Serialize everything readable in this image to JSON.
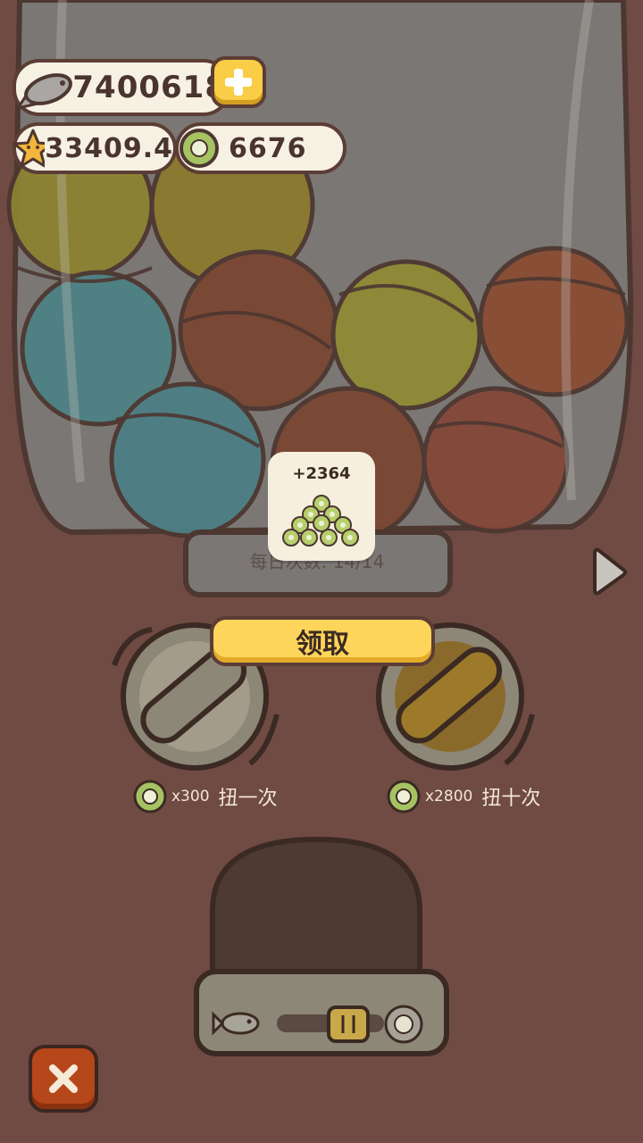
{
  "currency": {
    "fish": "7400618",
    "star": "33409.4",
    "coin": "6676"
  },
  "reward": {
    "amount": "+2364"
  },
  "daily": {
    "label": "每日次数: 14/14"
  },
  "claim_button": "领取",
  "single_spin": {
    "cost": "x300",
    "label": "扭一次"
  },
  "ten_spin": {
    "cost": "x2800",
    "label": "扭十次"
  },
  "colors": {
    "background": "#6f4b43",
    "accent_yellow": "#fdd55a",
    "pill_bg": "#f7f1e3",
    "close_red": "#b5471a"
  }
}
